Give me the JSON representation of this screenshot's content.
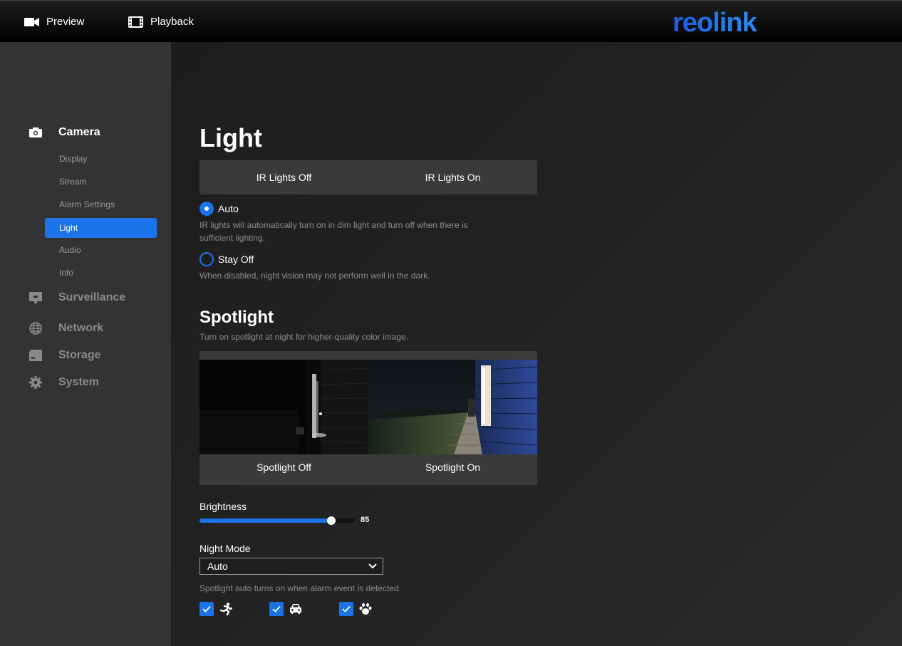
{
  "topbar": {
    "preview_label": "Preview",
    "playback_label": "Playback",
    "logo_text": "reolink",
    "brand_color": "#1a73e8"
  },
  "sidebar": {
    "camera": "Camera",
    "camera_items": [
      "Display",
      "Stream",
      "Alarm Settings",
      "Light",
      "Audio",
      "Info"
    ],
    "active_item": "Light",
    "surveillance": "Surveillance",
    "network": "Network",
    "storage": "Storage",
    "system": "System"
  },
  "light": {
    "title": "Light",
    "ir_off_label": "IR Lights Off",
    "ir_on_label": "IR Lights On",
    "auto_label": "Auto",
    "auto_desc": "IR lights will automatically turn on in dim light and turn off when there is sufficient lighting.",
    "stayoff_label": "Stay Off",
    "stayoff_desc": "When disabled, night vision may not perform well in the dark.",
    "selected": "Auto"
  },
  "spotlight": {
    "title": "Spotlight",
    "desc": "Turn on spotlight at night for higher-quality color image.",
    "off_label": "Spotlight Off",
    "on_label": "Spotlight On",
    "brightness_label": "Brightness",
    "brightness_value": "85",
    "brightness_percent": 85,
    "night_mode_label": "Night Mode",
    "night_mode_value": "Auto",
    "night_mode_desc": "Spotlight auto turns on when alarm event is detected.",
    "triggers": [
      {
        "icon": "person-running-icon",
        "checked": true
      },
      {
        "icon": "vehicle-icon",
        "checked": true
      },
      {
        "icon": "pet-paw-icon",
        "checked": true
      }
    ]
  }
}
